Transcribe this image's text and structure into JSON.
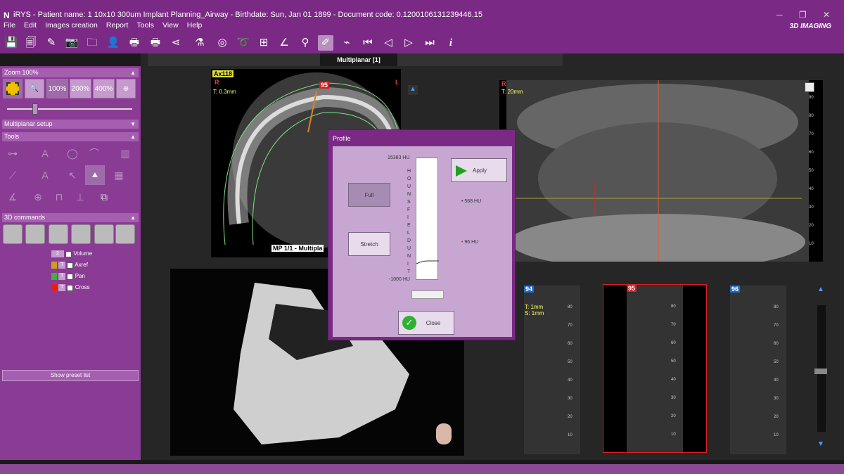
{
  "app": {
    "logo": "N",
    "title": "iRYS - Patient name: 1 10x10 300um Implant Planning_Airway - Birthdate: Sun, Jan 01 1899 - Document code: 0.12001061312394​46.15",
    "brand": "3D IMAGING"
  },
  "menu": [
    "File",
    "Edit",
    "Images creation",
    "Report",
    "Tools",
    "View",
    "Help"
  ],
  "toolbar_icons": [
    "save-icon",
    "save-as-icon",
    "edit-icon",
    "camera-icon",
    "import-icon",
    "user-add-icon",
    "print-icon",
    "print-multi-icon",
    "share-icon",
    "chart-icon",
    "eye-icon",
    "lasso-icon",
    "measure-icon",
    "angle-icon",
    "implant-icon",
    "pen-icon",
    "profile-icon",
    "first-icon",
    "prev-icon",
    "next-icon",
    "last-icon",
    "info-icon"
  ],
  "left": {
    "zoom_section": "Zoom 100%",
    "zoom_buttons": [
      "100%",
      "200%",
      "400%"
    ],
    "mp_section": "Multiplanar setup",
    "tools_section": "Tools",
    "cmd_section": "3D commands",
    "layers": [
      {
        "num": "2",
        "label": "Volume",
        "color": "",
        "checked": "✓"
      },
      {
        "num": "T",
        "label": "Axref",
        "color": "#c8a020",
        "checked": ""
      },
      {
        "num": "T",
        "label": "Pan",
        "color": "#40b040",
        "checked": ""
      },
      {
        "num": "T",
        "label": "Cross",
        "color": "#e02020",
        "checked": ""
      }
    ],
    "preset_button": "Show preset list"
  },
  "main": {
    "active_tab": "Multiplanar [1]",
    "axial": {
      "label": "Ax118",
      "r": "R",
      "l": "L",
      "thickness": "T: 0.3mm",
      "cross_marker": "95",
      "caption": "MP 1/1 - Multipla"
    },
    "pano": {
      "r": "R",
      "l": "L",
      "thickness": "T: 20mm",
      "ticks": [
        "90",
        "80",
        "70",
        "60",
        "50",
        "40",
        "30",
        "20",
        "10"
      ]
    },
    "cross": [
      {
        "num": "94",
        "info1": "T: 1mm",
        "info2": "S: 1mm"
      },
      {
        "num": "95",
        "info1": "",
        "info2": ""
      },
      {
        "num": "96",
        "info1": "",
        "info2": ""
      }
    ],
    "cross_ticks": [
      "80",
      "70",
      "60",
      "50",
      "40",
      "30",
      "20",
      "10"
    ]
  },
  "profile": {
    "title": "Profile",
    "max": "15383 HU",
    "min": "-1000 HU",
    "axis_label": "HOUNSFIELD UNIT",
    "full_btn": "Full",
    "stretch_btn": "Stretch",
    "apply_btn": "Apply",
    "val1": "568 HU",
    "val2": "96 HU",
    "close_btn": "Close"
  }
}
